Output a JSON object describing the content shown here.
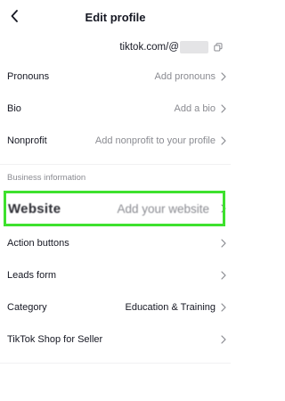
{
  "header": {
    "title": "Edit profile"
  },
  "url_row": {
    "text": "tiktok.com/@"
  },
  "profile_rows": [
    {
      "label": "Pronouns",
      "value": "Add pronouns"
    },
    {
      "label": "Bio",
      "value": "Add a bio"
    },
    {
      "label": "Nonprofit",
      "value": "Add nonprofit to your profile"
    }
  ],
  "business": {
    "section_title": "Business information",
    "website": {
      "label": "Website",
      "value": "Add your website"
    },
    "rows": [
      {
        "label": "Action buttons",
        "value": ""
      },
      {
        "label": "Leads form",
        "value": ""
      },
      {
        "label": "Category",
        "value": "Education & Training"
      },
      {
        "label": "TikTok Shop for Seller",
        "value": ""
      }
    ]
  },
  "colors": {
    "text": "#161823",
    "muted": "#8a8b91",
    "highlight": "#3ee12e"
  }
}
